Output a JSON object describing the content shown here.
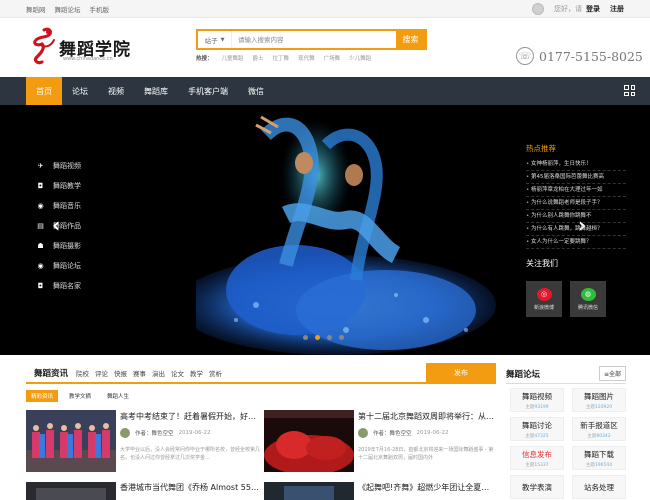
{
  "topbar": {
    "links": [
      "舞蹈网",
      "舞蹈论坛",
      "手机版"
    ],
    "greeting": "您好，请",
    "login": "登录",
    "register": "注册"
  },
  "logo": {
    "name": "舞蹈学院",
    "url": "www.chinadance.cn"
  },
  "search": {
    "type": "站子",
    "placeholder": "请输入搜索内容",
    "button": "搜索",
    "hot_label": "热搜：",
    "hot_terms": [
      "儿童舞蹈",
      "爵士",
      "拉丁舞",
      "现代舞",
      "广场舞",
      "少儿舞蹈"
    ]
  },
  "phone": "0177-5155-8025",
  "nav": {
    "items": [
      "首页",
      "论坛",
      "视频",
      "舞蹈库",
      "手机客户端",
      "微信"
    ],
    "active": 0
  },
  "hero": {
    "sidebar": [
      {
        "icon": "plane-icon",
        "glyph": "✈",
        "label": "舞蹈视频"
      },
      {
        "icon": "camera-icon",
        "glyph": "◘",
        "label": "舞蹈教学"
      },
      {
        "icon": "globe-icon",
        "glyph": "◉",
        "label": "舞蹈音乐"
      },
      {
        "icon": "folder-icon",
        "glyph": "▤",
        "label": "舞蹈作品"
      },
      {
        "icon": "users-icon",
        "glyph": "☗",
        "label": "舞蹈摄影"
      },
      {
        "icon": "globe-icon",
        "glyph": "◉",
        "label": "舞蹈论坛"
      },
      {
        "icon": "camera-icon",
        "glyph": "◘",
        "label": "舞蹈名家"
      }
    ],
    "hot_title": "热点推荐",
    "hot_items": [
      "女神杨丽萍，生日快乐！",
      "第45届洛桑国际芭蕾舞比赛高",
      "杨丽萍章龙柏在大理过年一如",
      "为什么说舞蹈老师是段子手？",
      "为什么别人跳舞你跳舞不",
      "为什么有人跳舞，跳舞越桓？",
      "女人为什么一定要跳舞？"
    ],
    "follow_title": "关注我们",
    "social": [
      {
        "label": "新浪微博",
        "icon": "weibo-icon"
      },
      {
        "label": "腾讯微信",
        "icon": "wechat-icon"
      }
    ],
    "slide_count": 4,
    "active_slide": 1
  },
  "news": {
    "title": "舞蹈资讯",
    "categories": [
      "院校",
      "评论",
      "快报",
      "赛事",
      "演出",
      "论文",
      "教学",
      "赏析"
    ],
    "post_button": "发布",
    "subtabs": [
      "精彩资讯",
      "教学文摘",
      "舞蹈人生"
    ],
    "active_subtab": 0,
    "cards": [
      {
        "title": "高考中考结束了！赶着暑假开始，好…",
        "author": "作者：舞色空空",
        "date": "2019-06-22",
        "desc": "大学毕业以后，没人会经常问你毕业于哪所名校，曾经全校第几名。也没人问过你曾经拿过几次奖学金..."
      },
      {
        "title": "第十二届北京舞蹈双周即将举行：从…",
        "author": "作者：舞色空空",
        "date": "2019-06-22",
        "desc": "2019年7月16-28日，首都北京将迎来一场国际舞蹈盛事 - 第十二届北京舞蹈双周，届时国内外"
      },
      {
        "title": "香港城市当代舞团《乔杨 Almost 55…"
      },
      {
        "title": "《起舞吧!齐舞》超燃少年团让全夏…"
      }
    ]
  },
  "forum": {
    "title": "舞蹈论坛",
    "all": "≡全部",
    "cells": [
      {
        "name": "舞蹈视频",
        "label": "主题",
        "count": "93199",
        "red": false
      },
      {
        "name": "舞蹈图片",
        "label": "主题",
        "count": "120920",
        "red": false
      },
      {
        "name": "舞蹈讨论",
        "label": "主题",
        "count": "47325",
        "red": false
      },
      {
        "name": "新手报道区",
        "label": "主题",
        "count": "80342",
        "red": false
      },
      {
        "name": "信息发布",
        "label": "主题",
        "count": "15337",
        "red": true
      },
      {
        "name": "舞蹈下载",
        "label": "主题",
        "count": "196544",
        "red": false
      },
      {
        "name": "教学表演",
        "label": "",
        "count": "",
        "red": false
      },
      {
        "name": "站务处理",
        "label": "",
        "count": "",
        "red": false
      }
    ]
  },
  "colors": {
    "accent": "#f39c12",
    "nav_bg": "#2d3640",
    "hot_title": "#f39c12"
  }
}
